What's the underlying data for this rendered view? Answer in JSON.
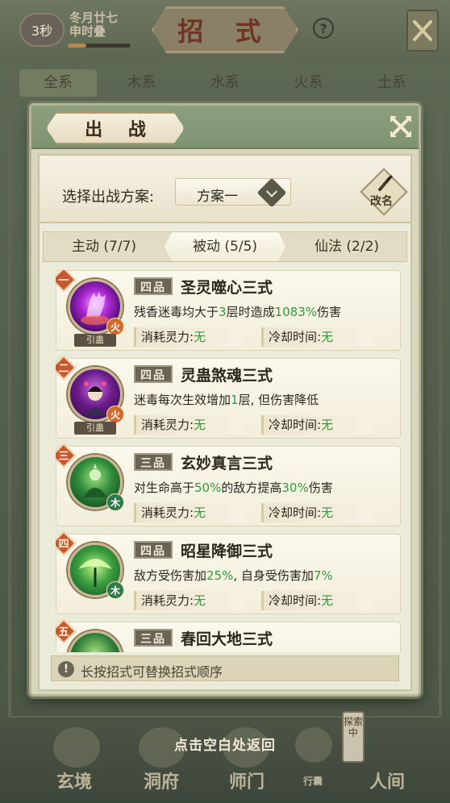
{
  "background": {
    "timer": "3秒",
    "date_line1": "冬月廿七",
    "date_line2": "申时叠",
    "date_progress": 0.3,
    "title": "招 式",
    "help": "?",
    "tabs": [
      "全系",
      "木系",
      "水系",
      "火系",
      "土系"
    ],
    "nav": {
      "xuanjing": "玄境",
      "dongfu": "洞府",
      "shimen": "师门",
      "xingnang": "行囊",
      "renjian": "人间"
    },
    "explore_badge": "探索中"
  },
  "return_hint": "点击空白处返回",
  "dialog": {
    "title": "出 战",
    "scheme_label": "选择出战方案:",
    "scheme_value": "方案一",
    "rename": "改名",
    "tabs": [
      {
        "label": "主动 (7/7)"
      },
      {
        "label": "被动 (5/5)"
      },
      {
        "label": "仙法 (2/2)"
      }
    ],
    "active_tab": 1,
    "cost_label": "消耗灵力:",
    "cooldown_label": "冷却时间:",
    "gu_label": "引蛊",
    "hint": "长按招式可替换招式顺序",
    "skills": [
      {
        "rank": "一",
        "grade": "四品",
        "name": "圣灵噬心三式",
        "desc_pre": "残香迷毒均大于",
        "desc_hl1": "3",
        "desc_mid": "层时造成",
        "desc_hl2": "1083%",
        "desc_post": "伤害",
        "cost": "无",
        "cooldown": "无",
        "element": "火",
        "gu": true
      },
      {
        "rank": "二",
        "grade": "四品",
        "name": "灵蛊煞魂三式",
        "desc_pre": "迷毒每次生效增加",
        "desc_hl1": "1",
        "desc_mid": "层, 但伤害降低",
        "desc_hl2": "",
        "desc_post": "",
        "cost": "无",
        "cooldown": "无",
        "element": "火",
        "gu": true
      },
      {
        "rank": "三",
        "grade": "三品",
        "name": "玄妙真言三式",
        "desc_pre": "对生命高于",
        "desc_hl1": "50%",
        "desc_mid": "的敌方提高",
        "desc_hl2": "30%",
        "desc_post": "伤害",
        "cost": "无",
        "cooldown": "无",
        "element": "木",
        "gu": false
      },
      {
        "rank": "四",
        "grade": "四品",
        "name": "昭星降御三式",
        "desc_pre": "敌方受伤害加",
        "desc_hl1": "25%",
        "desc_mid": ", 自身受伤害加",
        "desc_hl2": "7%",
        "desc_post": "",
        "cost": "无",
        "cooldown": "无",
        "element": "木",
        "gu": false
      },
      {
        "rank": "五",
        "grade": "三品",
        "name": "春回大地三式",
        "desc_pre": "",
        "desc_hl1": "",
        "desc_mid": "",
        "desc_hl2": "",
        "desc_post": "",
        "cost": "",
        "cooldown": "",
        "element": "木",
        "gu": false
      }
    ]
  },
  "colors": {
    "highlight_green": "#2f9a3a",
    "rank_orange": "#c8582c",
    "dialog_header_green": "#8ca07e",
    "fire_badge": "#d26a2a",
    "wood_badge": "#2f7a4a"
  }
}
